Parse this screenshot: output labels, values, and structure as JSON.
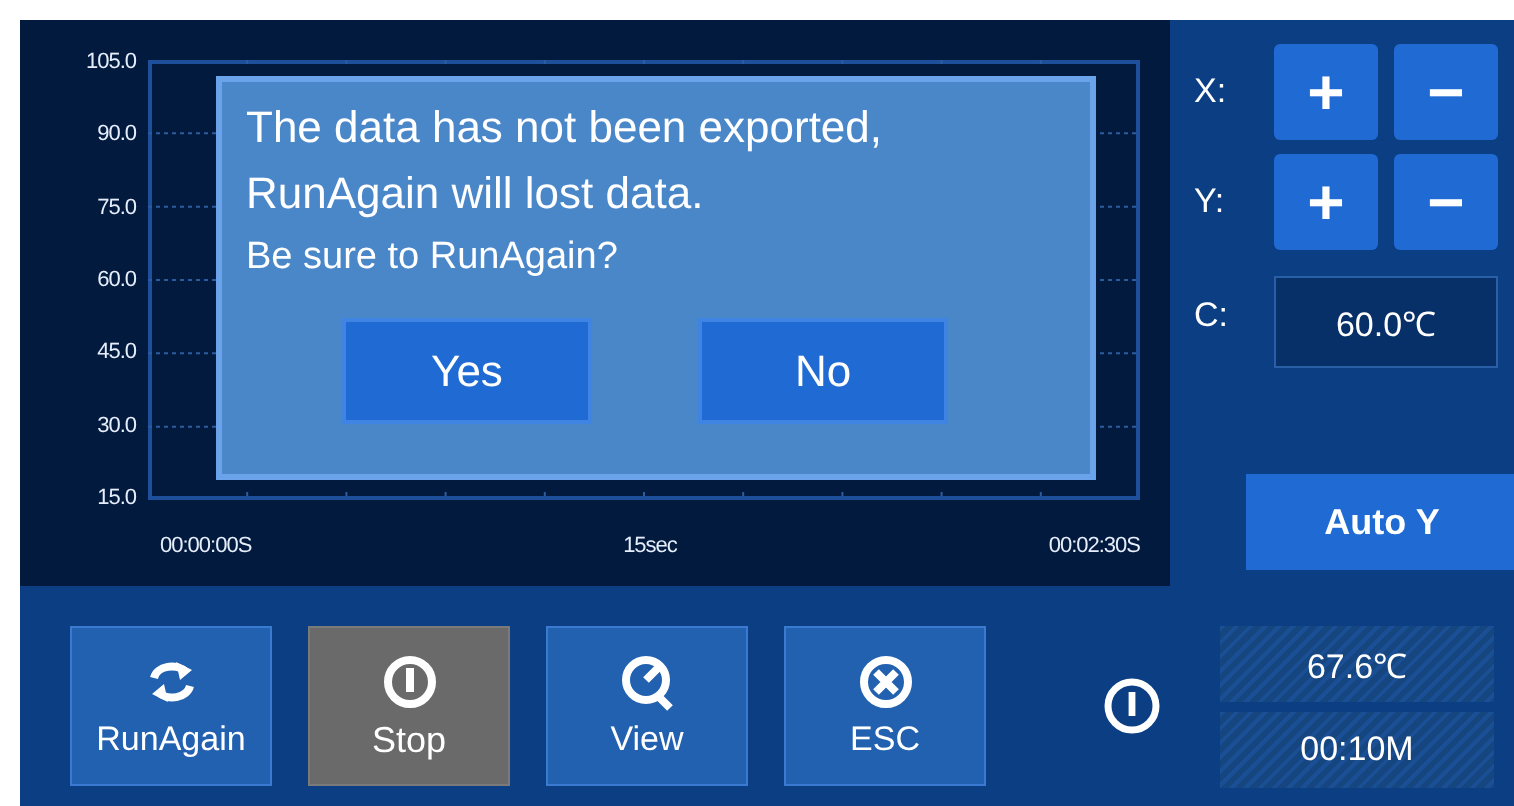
{
  "plot": {
    "y_labels": [
      "105.0",
      "90.0",
      "75.0",
      "60.0",
      "45.0",
      "30.0",
      "15.0"
    ],
    "x_labels": [
      "00:00:00S",
      "15sec",
      "00:02:30S"
    ]
  },
  "dialog": {
    "lines": [
      "The data has not been exported,",
      "RunAgain will lost data.",
      "Be sure to RunAgain?"
    ],
    "buttons": [
      {
        "label": "Yes"
      },
      {
        "label": "No"
      }
    ]
  },
  "axis_controls": [
    {
      "label": "X:",
      "buttons": [
        "+",
        "−"
      ]
    },
    {
      "label": "Y:",
      "buttons": [
        "+",
        "−"
      ]
    }
  ],
  "c_control": {
    "label": "C:",
    "value": "60.0℃"
  },
  "auto_y": "Auto Y",
  "toolbar": [
    {
      "kind": "cycle",
      "label": "RunAgain",
      "selected": false
    },
    {
      "kind": "power",
      "label": "Stop",
      "selected": true
    },
    {
      "kind": "gauge",
      "label": "View",
      "selected": false
    },
    {
      "kind": "cancel",
      "label": "ESC",
      "selected": false
    }
  ],
  "readouts": [
    "67.6℃",
    "00:10M"
  ]
}
